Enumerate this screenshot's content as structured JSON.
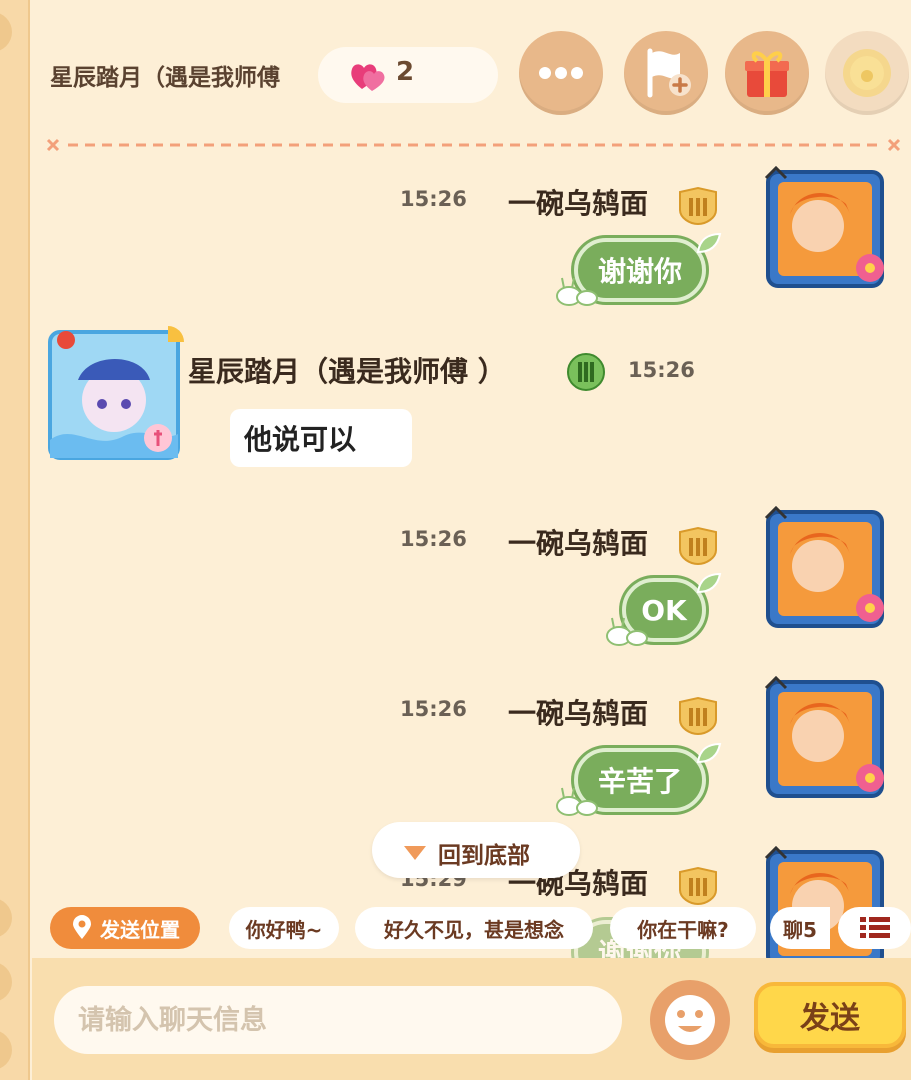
{
  "header": {
    "peer_name": "星辰踏月（遇是我师傅",
    "intimacy_count": "2",
    "buttons": [
      "more-icon",
      "add-friend-flag-icon",
      "gift-icon",
      "coin-icon"
    ]
  },
  "messages": [
    {
      "side": "right",
      "time": "15:26",
      "sender": "一碗乌鸫面",
      "text": "谢谢你"
    },
    {
      "side": "left",
      "time": "15:26",
      "sender": "星辰踏月（遇是我师傅 ）",
      "text": "他说可以"
    },
    {
      "side": "right",
      "time": "15:26",
      "sender": "一碗乌鸫面",
      "text": "OK"
    },
    {
      "side": "right",
      "time": "15:26",
      "sender": "一碗乌鸫面",
      "text": "辛苦了"
    },
    {
      "side": "right",
      "time": "15:29",
      "sender": "一碗乌鸫面",
      "text": "谢谢你"
    }
  ],
  "back_to_bottom": "回到底部",
  "quick_phrases": {
    "send_location": "发送位置",
    "items": [
      "你好鸭~",
      "好久不见，甚是想念",
      "你在干嘛?",
      "聊5"
    ]
  },
  "input": {
    "placeholder": "请输入聊天信息",
    "send_label": "发送"
  },
  "colors": {
    "background": "#fdefd6",
    "my_bubble": "#7aad5c",
    "accent_orange": "#f08c3c",
    "send_button": "#ffd74a"
  }
}
